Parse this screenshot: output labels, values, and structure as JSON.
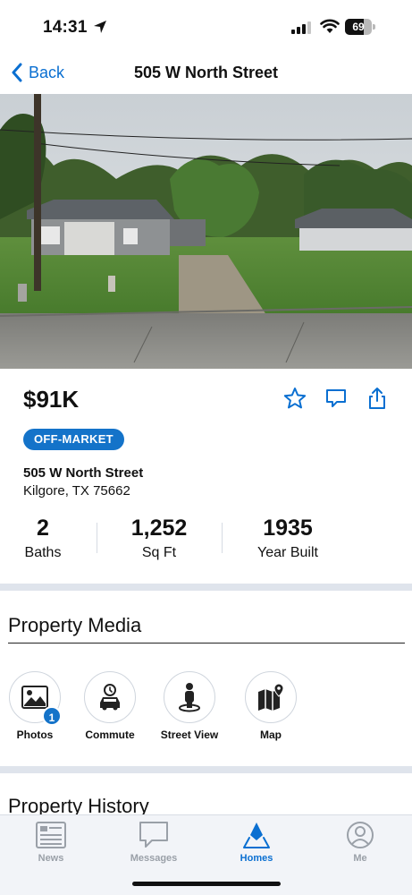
{
  "status_bar": {
    "time": "14:31",
    "battery_level": 69,
    "battery_text": "69"
  },
  "nav": {
    "back_label": "Back",
    "title": "505 W North Street"
  },
  "listing": {
    "price": "$91K",
    "status_badge": "OFF-MARKET",
    "address_line1": "505 W North Street",
    "address_line2": "Kilgore, TX 75662",
    "stats": [
      {
        "value": "2",
        "label": "Baths"
      },
      {
        "value": "1,252",
        "label": "Sq Ft"
      },
      {
        "value": "1935",
        "label": "Year Built"
      }
    ]
  },
  "property_media": {
    "title": "Property Media",
    "items": [
      {
        "label": "Photos",
        "icon": "photos-icon",
        "count": "1"
      },
      {
        "label": "Commute",
        "icon": "commute-icon"
      },
      {
        "label": "Street View",
        "icon": "street-view-icon"
      },
      {
        "label": "Map",
        "icon": "map-icon"
      }
    ]
  },
  "property_history": {
    "title": "Property History"
  },
  "tabbar": {
    "tabs": [
      {
        "label": "News",
        "icon": "news-icon",
        "active": false
      },
      {
        "label": "Messages",
        "icon": "messages-icon",
        "active": false
      },
      {
        "label": "Homes",
        "icon": "homes-icon",
        "active": true
      },
      {
        "label": "Me",
        "icon": "profile-icon",
        "active": false
      }
    ]
  },
  "colors": {
    "accent": "#0a6fd1",
    "badge": "#1473c9",
    "divider_band": "#dfe4ec",
    "inactive_tab": "#9aa0a8"
  }
}
